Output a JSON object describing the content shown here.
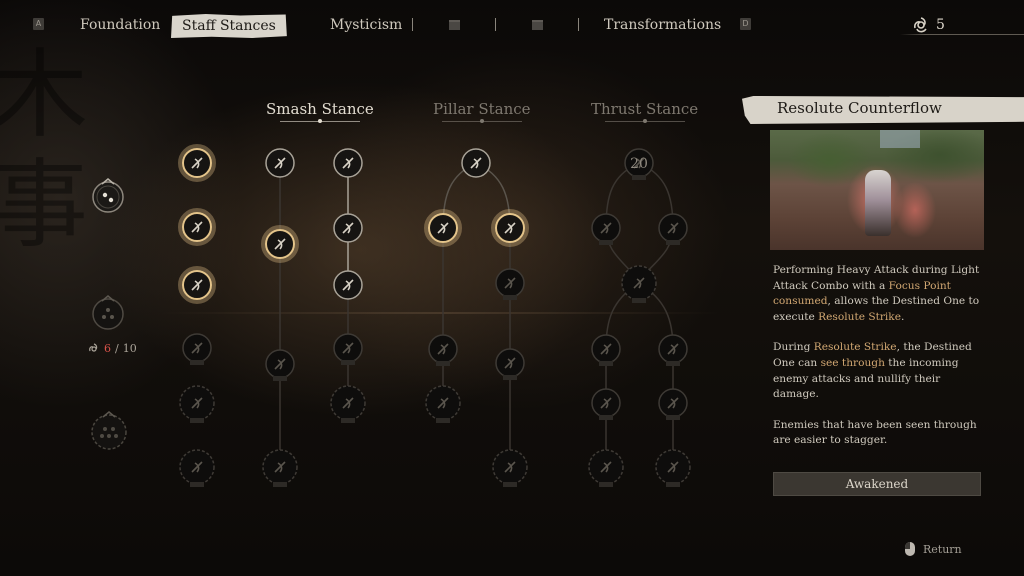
{
  "nav": {
    "left_key": "A",
    "right_key": "D",
    "tabs": [
      {
        "label": "Foundation",
        "state": "normal"
      },
      {
        "label": "Staff Stances",
        "state": "active"
      },
      {
        "label": "Mysticism",
        "state": "normal"
      },
      {
        "label": "",
        "state": "locked"
      },
      {
        "label": "",
        "state": "locked"
      },
      {
        "label": "Transformations",
        "state": "normal"
      }
    ],
    "currency": {
      "icon": "spark-icon",
      "value": "5"
    }
  },
  "left_column": {
    "rank_icons": [
      "stance-rank-1-icon",
      "stance-rank-2-icon",
      "stance-rank-3-icon"
    ],
    "points": {
      "current": "6",
      "separator": " / ",
      "max": "10"
    }
  },
  "stances": [
    {
      "name": "Smash Stance",
      "active": true
    },
    {
      "name": "Pillar Stance",
      "active": false
    },
    {
      "name": "Thrust Stance",
      "active": false
    }
  ],
  "thrust_root_label": "20",
  "detail": {
    "title": "Resolute Counterflow",
    "paragraphs": [
      [
        {
          "t": "Performing Heavy Attack during Light Attack Combo with a "
        },
        {
          "t": "Focus Point consumed",
          "hl": true
        },
        {
          "t": ", allows the Destined One to execute "
        },
        {
          "t": "Resolute Strike",
          "hl": true
        },
        {
          "t": "."
        }
      ],
      [
        {
          "t": "During "
        },
        {
          "t": "Resolute Strike",
          "hl": true
        },
        {
          "t": ", the Destined One can "
        },
        {
          "t": "see through",
          "hl": true
        },
        {
          "t": " the incoming enemy attacks and nullify their damage."
        }
      ],
      [
        {
          "t": "Enemies that have been seen through are easier to stagger."
        }
      ]
    ],
    "status": "Awakened"
  },
  "footer": {
    "return_label": "Return"
  },
  "colors": {
    "accent": "#d1a772",
    "gold_ring": "#e4c48a",
    "points_current": "#d9534a"
  }
}
